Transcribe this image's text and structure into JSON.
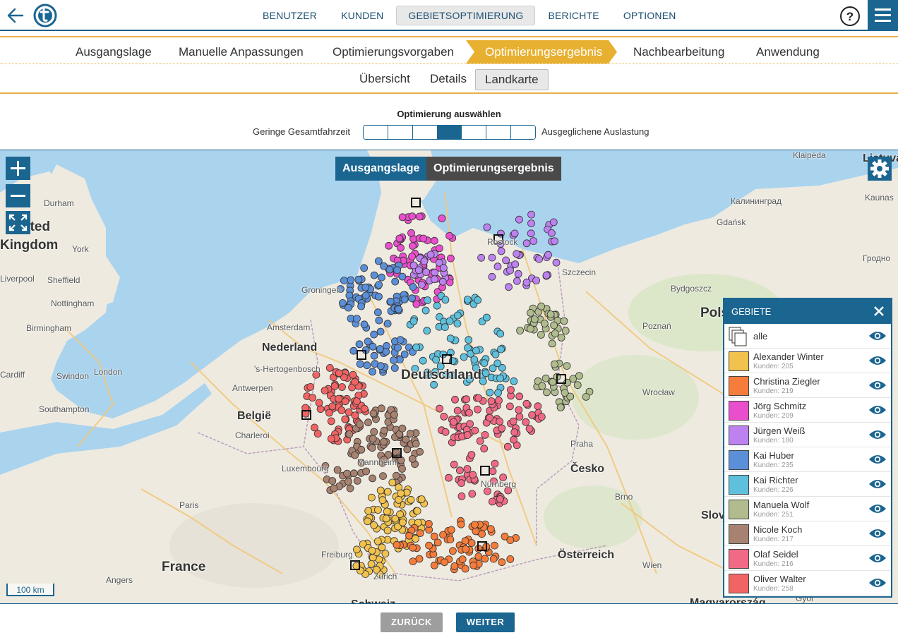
{
  "nav": {
    "items": [
      {
        "label": "BENUTZER",
        "active": false
      },
      {
        "label": "KUNDEN",
        "active": false
      },
      {
        "label": "GEBIETSOPTIMIERUNG",
        "active": true
      },
      {
        "label": "BERICHTE",
        "active": false
      },
      {
        "label": "OPTIONEN",
        "active": false
      }
    ],
    "help_label": "?"
  },
  "steps": [
    {
      "label": "Ausgangslage",
      "active": false
    },
    {
      "label": "Manuelle Anpassungen",
      "active": false
    },
    {
      "label": "Optimierungsvorgaben",
      "active": false
    },
    {
      "label": "Optimierungsergebnis",
      "active": true
    },
    {
      "label": "Nachbearbeitung",
      "active": false
    },
    {
      "label": "Anwendung",
      "active": false
    }
  ],
  "subtabs": [
    {
      "label": "Übersicht",
      "active": false
    },
    {
      "label": "Details",
      "active": false
    },
    {
      "label": "Landkarte",
      "active": true
    }
  ],
  "selector": {
    "title": "Optimierung auswählen",
    "left_label": "Geringe Gesamtfahrzeit",
    "right_label": "Ausgeglichene Auslastung",
    "segments": 7,
    "selected_index": 3
  },
  "map": {
    "mode_buttons": [
      "Ausgangslage",
      "Optimierungsergebnis"
    ],
    "scale_label": "100 km",
    "labels": [
      {
        "text": "Klaipėda",
        "cls": ""
      },
      {
        "text": "Lietuva",
        "cls": "mid"
      },
      {
        "text": "Kaunas",
        "cls": ""
      },
      {
        "text": "Калининград",
        "cls": ""
      },
      {
        "text": "Gdańsk",
        "cls": ""
      },
      {
        "text": "Гродно",
        "cls": ""
      },
      {
        "text": "Durham",
        "cls": ""
      },
      {
        "text": "United",
        "cls": "big"
      },
      {
        "text": "Kingdom",
        "cls": "big"
      },
      {
        "text": "York",
        "cls": ""
      },
      {
        "text": "Liverpool",
        "cls": ""
      },
      {
        "text": "Sheffield",
        "cls": ""
      },
      {
        "text": "Nottingham",
        "cls": ""
      },
      {
        "text": "Birmingham",
        "cls": ""
      },
      {
        "text": "London",
        "cls": ""
      },
      {
        "text": "Swindon",
        "cls": ""
      },
      {
        "text": "Cardiff",
        "cls": ""
      },
      {
        "text": "Southampton",
        "cls": ""
      },
      {
        "text": "Rostock",
        "cls": ""
      },
      {
        "text": "Szczecin",
        "cls": ""
      },
      {
        "text": "Bydgoszcz",
        "cls": ""
      },
      {
        "text": "Groningen",
        "cls": ""
      },
      {
        "text": "Amsterdam",
        "cls": ""
      },
      {
        "text": "Nederland",
        "cls": "mid"
      },
      {
        "text": "'s-Hertogenbosch",
        "cls": ""
      },
      {
        "text": "Antwerpen",
        "cls": ""
      },
      {
        "text": "België",
        "cls": "mid"
      },
      {
        "text": "Charleroi",
        "cls": ""
      },
      {
        "text": "Luxembourg",
        "cls": ""
      },
      {
        "text": "Paris",
        "cls": ""
      },
      {
        "text": "France",
        "cls": "big"
      },
      {
        "text": "Angers",
        "cls": ""
      },
      {
        "text": "Poznań",
        "cls": ""
      },
      {
        "text": "Polska",
        "cls": "big"
      },
      {
        "text": "Wrocław",
        "cls": ""
      },
      {
        "text": "Praha",
        "cls": ""
      },
      {
        "text": "Česko",
        "cls": "mid"
      },
      {
        "text": "Brno",
        "cls": ""
      },
      {
        "text": "Österreich",
        "cls": "mid"
      },
      {
        "text": "Wien",
        "cls": ""
      },
      {
        "text": "Slovensko",
        "cls": "mid"
      },
      {
        "text": "Deutschland",
        "cls": "big"
      },
      {
        "text": "Freiburg",
        "cls": ""
      },
      {
        "text": "Zürich",
        "cls": ""
      },
      {
        "text": "Schweiz",
        "cls": "mid"
      },
      {
        "text": "Magyarország",
        "cls": "mid"
      },
      {
        "text": "Győr",
        "cls": ""
      },
      {
        "text": "Mannheim",
        "cls": ""
      },
      {
        "text": "Nürnberg",
        "cls": ""
      }
    ]
  },
  "panel": {
    "title": "GEBIETE",
    "all_label": "alle",
    "regions": [
      {
        "name": "Alexander Winter",
        "count": "Kunden: 205",
        "color": "#f1c24e"
      },
      {
        "name": "Christina Ziegler",
        "count": "Kunden: 219",
        "color": "#f57c3b"
      },
      {
        "name": "Jörg Schmitz",
        "count": "Kunden: 209",
        "color": "#e94fcc"
      },
      {
        "name": "Jürgen Weiß",
        "count": "Kunden: 180",
        "color": "#bd82f0"
      },
      {
        "name": "Kai Huber",
        "count": "Kunden: 235",
        "color": "#5b8fd8"
      },
      {
        "name": "Kai Richter",
        "count": "Kunden: 226",
        "color": "#5ec0dc"
      },
      {
        "name": "Manuela Wolf",
        "count": "Kunden: 251",
        "color": "#b0bc8e"
      },
      {
        "name": "Nicole Koch",
        "count": "Kunden: 217",
        "color": "#a88270"
      },
      {
        "name": "Olaf Seidel",
        "count": "Kunden: 216",
        "color": "#f06a86"
      },
      {
        "name": "Oliver Walter",
        "count": "Kunden: 258",
        "color": "#f26464"
      }
    ]
  },
  "footer": {
    "back_label": "ZURÜCK",
    "next_label": "WEITER"
  }
}
